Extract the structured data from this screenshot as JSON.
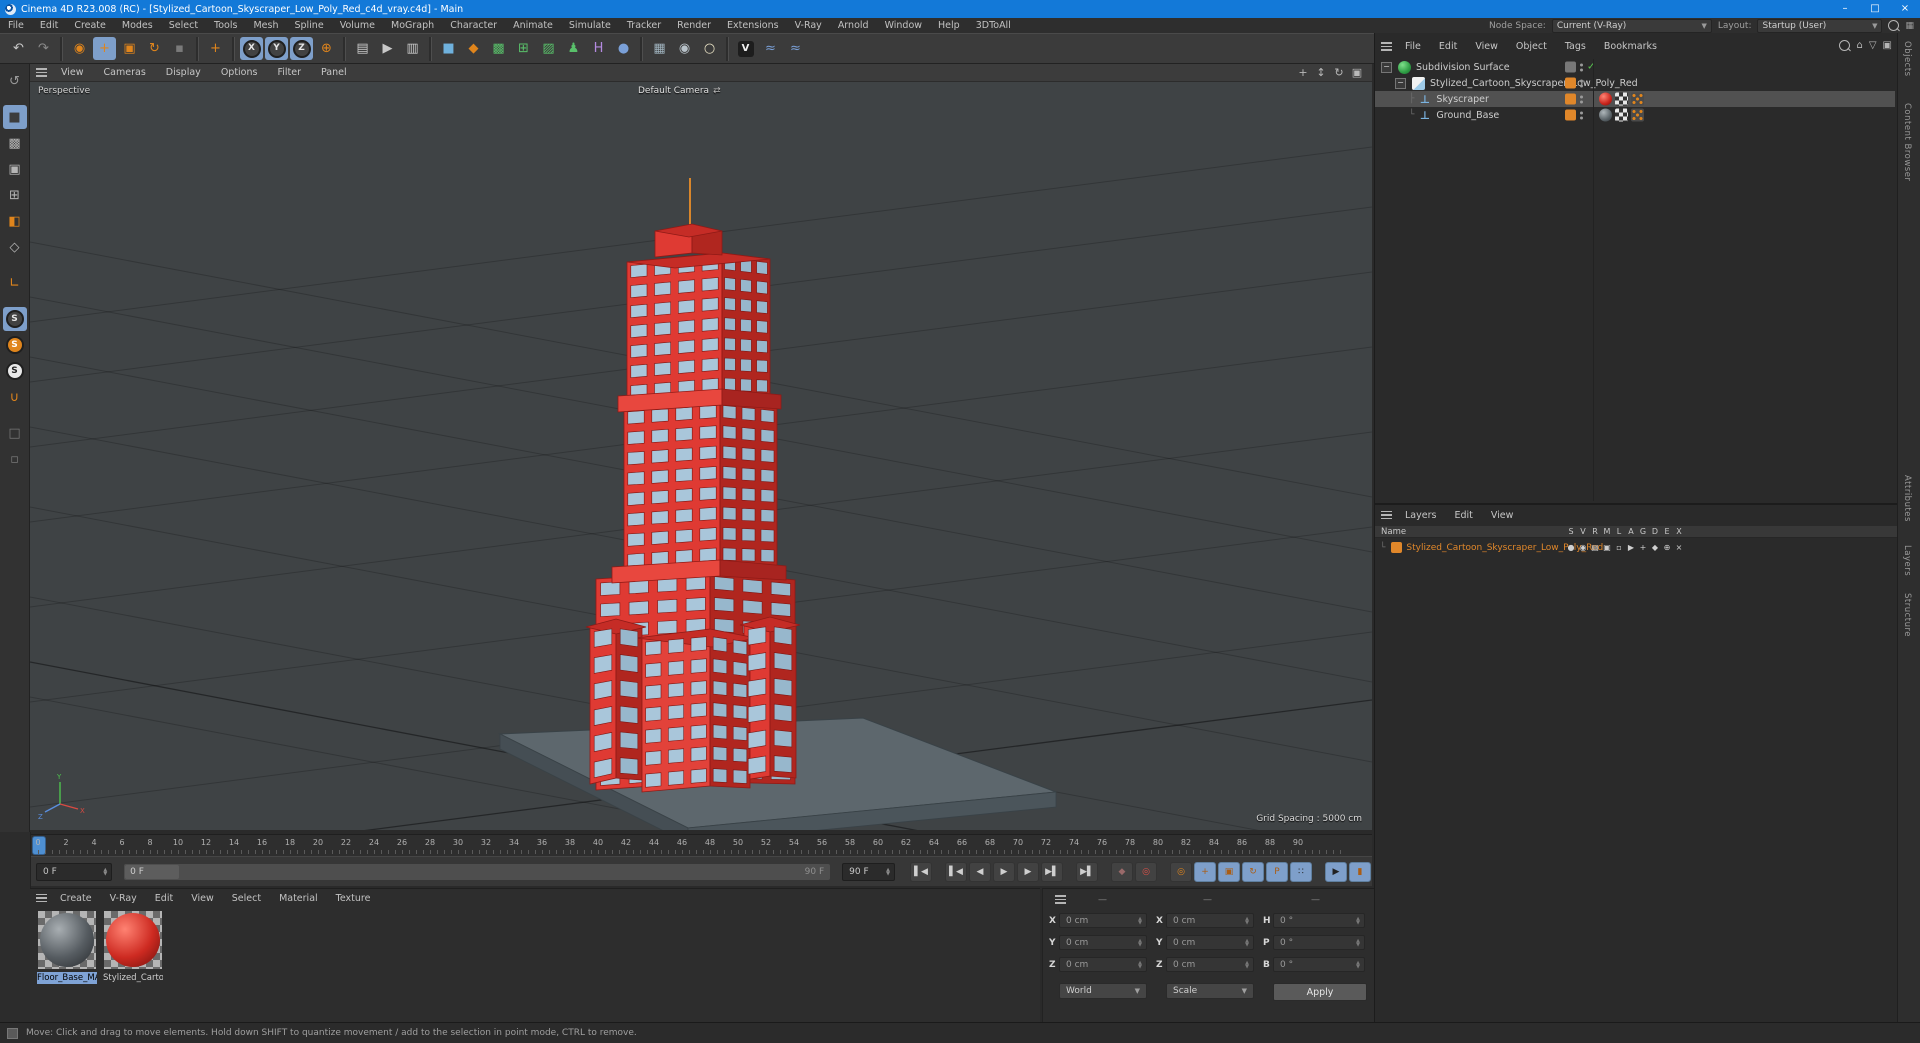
{
  "window": {
    "title": "Cinema 4D R23.008 (RC) - [Stylized_Cartoon_Skyscraper_Low_Poly_Red_c4d_vray.c4d] - Main",
    "minimize": "–",
    "maximize": "□",
    "close": "×"
  },
  "menubar": {
    "items": [
      "File",
      "Edit",
      "Create",
      "Modes",
      "Select",
      "Tools",
      "Mesh",
      "Spline",
      "Volume",
      "MoGraph",
      "Character",
      "Animate",
      "Simulate",
      "Tracker",
      "Render",
      "Extensions",
      "V-Ray",
      "Arnold",
      "Window",
      "Help",
      "3DToAll"
    ],
    "node_space_label": "Node Space:",
    "node_space_value": "Current (V-Ray)",
    "layout_label": "Layout:",
    "layout_value": "Startup (User)"
  },
  "toolbar": {
    "items": [
      {
        "name": "undo-button",
        "glyph": "↶",
        "c": "#c8c8c8"
      },
      {
        "name": "redo-button",
        "glyph": "↷",
        "c": "#8a8a8a"
      },
      {
        "name": "separator",
        "sep": true
      },
      {
        "name": "live-selection-tool",
        "glyph": "◉",
        "c": "#e0851c"
      },
      {
        "name": "move-tool",
        "glyph": "+",
        "c": "#e0851c",
        "sel": true,
        "bold": true
      },
      {
        "name": "scale-tool",
        "glyph": "▣",
        "c": "#e0851c"
      },
      {
        "name": "rotate-tool",
        "glyph": "↻",
        "c": "#e0851c"
      },
      {
        "name": "last-tool-button",
        "glyph": "▪",
        "c": "#7a7a7a"
      },
      {
        "name": "separator",
        "sep": true
      },
      {
        "name": "axis-modifier-tool",
        "glyph": "+",
        "c": "#e0851c",
        "bold": true
      },
      {
        "name": "separator",
        "sep": true
      },
      {
        "name": "lock-x-button",
        "glyph": "X",
        "c": "#e6e6e6",
        "sel": true,
        "circ": true
      },
      {
        "name": "lock-y-button",
        "glyph": "Y",
        "c": "#e6e6e6",
        "sel": true,
        "circ": true
      },
      {
        "name": "lock-z-button",
        "glyph": "Z",
        "c": "#e6e6e6",
        "sel": true,
        "circ": true
      },
      {
        "name": "coordinate-system-button",
        "glyph": "⊕",
        "c": "#e0851c"
      },
      {
        "name": "separator",
        "sep": true
      },
      {
        "name": "render-view-button",
        "glyph": "▤",
        "c": "#c8c8c8"
      },
      {
        "name": "render-picture-viewer-button",
        "glyph": "▶",
        "c": "#c8c8c8"
      },
      {
        "name": "render-settings-button",
        "glyph": "▥",
        "c": "#c8c8c8"
      },
      {
        "name": "separator",
        "sep": true
      },
      {
        "name": "add-primitive-button",
        "glyph": "■",
        "c": "#6fb1dd"
      },
      {
        "name": "spline-pen-button",
        "glyph": "◆",
        "c": "#e0851c"
      },
      {
        "name": "subdivision-surface-button",
        "glyph": "▩",
        "c": "#59c06a"
      },
      {
        "name": "array-generator-button",
        "glyph": "⊞",
        "c": "#59c06a"
      },
      {
        "name": "deformer-button",
        "glyph": "▨",
        "c": "#59c06a"
      },
      {
        "name": "character-button",
        "glyph": "♟",
        "c": "#59c06a"
      },
      {
        "name": "spline-helper-button",
        "glyph": "H",
        "c": "#b48ae0"
      },
      {
        "name": "volume-button",
        "glyph": "●",
        "c": "#7aa0d8"
      },
      {
        "name": "separator",
        "sep": true
      },
      {
        "name": "floor-button",
        "glyph": "▦",
        "c": "#9fb2bd"
      },
      {
        "name": "camera-button",
        "glyph": "◉",
        "c": "#b8c2c9"
      },
      {
        "name": "light-button",
        "glyph": "○",
        "c": "#e6dfc2"
      },
      {
        "name": "separator",
        "sep": true
      },
      {
        "name": "vray-button",
        "glyph": "V",
        "c": "#f0f0f0",
        "chipbg": true
      },
      {
        "name": "script-button-1",
        "glyph": "≈",
        "c": "#7aa0d8"
      },
      {
        "name": "script-button-2",
        "glyph": "≈",
        "c": "#7aa0d8"
      }
    ]
  },
  "palette": {
    "items": [
      {
        "name": "make-editable-button",
        "glyph": "↺",
        "c": "#9a9a9a"
      },
      {
        "name": "model-mode-button",
        "glyph": "■",
        "c": "#3c3c3c",
        "sel": true,
        "gapTop": true
      },
      {
        "name": "texture-mode-button",
        "glyph": "▩",
        "c": "#b5b5b5"
      },
      {
        "name": "workplane-mode-button",
        "glyph": "▣",
        "c": "#b5b5b5"
      },
      {
        "name": "points-mode-button",
        "glyph": "⊞",
        "c": "#b5b5b5"
      },
      {
        "name": "polygons-mode-button",
        "glyph": "◧",
        "c": "#e0851c"
      },
      {
        "name": "edges-mode-button",
        "glyph": "◇",
        "c": "#b5b5b5"
      },
      {
        "name": "enable-axis-button",
        "glyph": "∟",
        "c": "#e0851c",
        "gapTop": true
      },
      {
        "name": "snap-enable-button",
        "glyph": "S",
        "c": "#e6e6e6",
        "sel": true,
        "circ": true,
        "gapTop": true
      },
      {
        "name": "snap-mode-button",
        "glyph": "S",
        "c": "#fff",
        "bgc": "#e0851c",
        "circ": true
      },
      {
        "name": "quantize-button",
        "glyph": "S",
        "c": "#222",
        "bgc": "#e8e8e8",
        "circ": true
      },
      {
        "name": "magnet-tool-button",
        "glyph": "∪",
        "c": "#e0851c"
      },
      {
        "name": "workplane-lock-button",
        "glyph": "□",
        "c": "#777",
        "gapTop": true
      },
      {
        "name": "misc-tool-button",
        "glyph": "▫",
        "c": "#777"
      }
    ]
  },
  "viewport": {
    "menu": [
      "View",
      "Cameras",
      "Display",
      "Options",
      "Filter",
      "Panel"
    ],
    "view_label": "Perspective",
    "camera_label": "Default Camera",
    "camera_swap_icon": "⇄",
    "grid_spacing": "Grid Spacing : 5000 cm",
    "nav": {
      "pan": "+",
      "zoom": "↕",
      "rotate": "↻",
      "toggle": "▣"
    },
    "axis": {
      "x": "X",
      "y": "Y",
      "z": "Z"
    }
  },
  "object_manager": {
    "menu": [
      "File",
      "Edit",
      "View",
      "Object",
      "Tags",
      "Bookmarks"
    ],
    "rows": [
      {
        "name": "Subdivision Surface"
      },
      {
        "name": "Stylized_Cartoon_Skyscraper_Low_Poly_Red"
      },
      {
        "name": "Skyscraper"
      },
      {
        "name": "Ground_Base"
      }
    ],
    "side_tabs_top": [
      "Objects",
      "Content Browser"
    ],
    "side_tabs_bottom": [
      "Attributes",
      "Layers",
      "Structure"
    ]
  },
  "layer_manager": {
    "menu": [
      "Layers",
      "Edit",
      "View"
    ],
    "name_header": "Name",
    "columns": [
      "S",
      "V",
      "R",
      "M",
      "L",
      "A",
      "G",
      "D",
      "E",
      "X"
    ],
    "row_name": "Stylized_Cartoon_Skyscraper_Low_Poly_Red"
  },
  "timeline": {
    "tick_start": 0,
    "tick_end": 90,
    "tick_step": 2,
    "current_frame": "0 F",
    "slider_start_label": "0 F",
    "slider_end_label": "90 F",
    "end_frame": "90 F"
  },
  "transport": {
    "buttons": [
      {
        "name": "goto-start-button",
        "glyph": "▌◀"
      },
      {
        "name": "prev-key-button",
        "glyph": "▌◀",
        "gap": true
      },
      {
        "name": "prev-frame-button",
        "glyph": "◀"
      },
      {
        "name": "play-button",
        "glyph": "▶"
      },
      {
        "name": "next-frame-button",
        "glyph": "▶"
      },
      {
        "name": "next-key-button",
        "glyph": "▶▌"
      },
      {
        "name": "goto-end-button",
        "glyph": "▶▌",
        "gap": true
      },
      {
        "name": "record-objects-button",
        "glyph": "◆",
        "c": "#9a6a6a",
        "gap": true
      },
      {
        "name": "autokey-button",
        "glyph": "◎",
        "c": "#e05048"
      },
      {
        "name": "keyframe-selection-button",
        "glyph": "◎",
        "c": "#e0851c",
        "gap": true
      },
      {
        "name": "record-position-toggle",
        "glyph": "+",
        "c": "#aa5d14",
        "sel": true
      },
      {
        "name": "record-scale-toggle",
        "glyph": "▣",
        "c": "#aa5d14",
        "sel": true
      },
      {
        "name": "record-rotation-toggle",
        "glyph": "↻",
        "c": "#aa5d14",
        "sel": true
      },
      {
        "name": "record-parameter-toggle",
        "glyph": "P",
        "c": "#aa5d14",
        "sel": true
      },
      {
        "name": "record-pla-toggle",
        "glyph": "∷",
        "c": "#222",
        "sel": true
      },
      {
        "name": "solo-animation-button",
        "glyph": "▶",
        "c": "#222",
        "sel": true,
        "gap": true
      },
      {
        "name": "sound-toggle-button",
        "glyph": "▮",
        "c": "#aa5d14",
        "sel": true
      }
    ]
  },
  "materials": {
    "menu": [
      "Create",
      "V-Ray",
      "Edit",
      "View",
      "Select",
      "Material",
      "Texture"
    ],
    "items": [
      {
        "name": "Floor_Base_MAT",
        "selected": true
      },
      {
        "name": "Stylized_Cartoon_"
      }
    ]
  },
  "coordinates": {
    "headers": [
      "—",
      "—",
      "—"
    ],
    "pos_x_label": "X",
    "pos_x": "0 cm",
    "pos_y_label": "Y",
    "pos_y": "0 cm",
    "pos_z_label": "Z",
    "pos_z": "0 cm",
    "size_x_label": "X",
    "size_x": "0 cm",
    "size_y_label": "Y",
    "size_y": "0 cm",
    "size_z_label": "Z",
    "size_z": "0 cm",
    "rot_h_label": "H",
    "rot_h": "0 °",
    "rot_p_label": "P",
    "rot_p": "0 °",
    "rot_b_label": "B",
    "rot_b": "0 °",
    "mode_dropdown": "World",
    "size_dropdown": "Scale",
    "apply_label": "Apply"
  },
  "statusbar": {
    "message": "Move: Click and drag to move elements. Hold down SHIFT to quantize movement / add to the selection in point mode, CTRL to remove."
  },
  "colors": {
    "titlebar_blue": "#1379d8",
    "accent_orange": "#e0851c",
    "highlight_blue": "#7e9fca",
    "building_red": "#df3a33",
    "building_red_dark": "#b0261f",
    "window_blue": "#a9c6da",
    "platform_gray": "#5d676d"
  }
}
